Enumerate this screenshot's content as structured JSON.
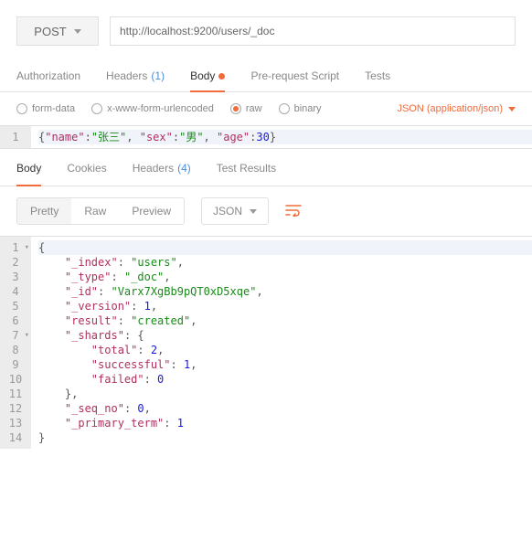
{
  "request": {
    "method": "POST",
    "url": "http://localhost:9200/users/_doc"
  },
  "reqTabs": {
    "authorization": "Authorization",
    "headers": "Headers",
    "headersCount": "(1)",
    "body": "Body",
    "prerequest": "Pre-request Script",
    "tests": "Tests"
  },
  "bodyTypes": {
    "formData": "form-data",
    "urlencoded": "x-www-form-urlencoded",
    "raw": "raw",
    "binary": "binary",
    "contentType": "JSON (application/json)"
  },
  "reqBody": {
    "line1": {
      "b1": "{",
      "k1": "\"name\"",
      "c1": ":",
      "v1": "\"张三\"",
      "c2": ", ",
      "k2": "\"sex\"",
      "c3": ":",
      "v2": "\"男\"",
      "c4": ", ",
      "k3": "\"age\"",
      "c5": ":",
      "v3": "30",
      "b2": "}"
    }
  },
  "respTabs": {
    "body": "Body",
    "cookies": "Cookies",
    "headers": "Headers",
    "headersCount": "(4)",
    "testResults": "Test Results"
  },
  "respToolbar": {
    "pretty": "Pretty",
    "raw": "Raw",
    "preview": "Preview",
    "lang": "JSON"
  },
  "respBody": {
    "l1": {
      "b": "{"
    },
    "l2": {
      "k": "\"_index\"",
      "v": "\"users\""
    },
    "l3": {
      "k": "\"_type\"",
      "v": "\"_doc\""
    },
    "l4": {
      "k": "\"_id\"",
      "v": "\"Varx7XgBb9pQT0xD5xqe\""
    },
    "l5": {
      "k": "\"_version\"",
      "v": "1"
    },
    "l6": {
      "k": "\"result\"",
      "v": "\"created\""
    },
    "l7": {
      "k": "\"_shards\"",
      "b": "{"
    },
    "l8": {
      "k": "\"total\"",
      "v": "2"
    },
    "l9": {
      "k": "\"successful\"",
      "v": "1"
    },
    "l10": {
      "k": "\"failed\"",
      "v": "0"
    },
    "l11": {
      "b": "},"
    },
    "l12": {
      "k": "\"_seq_no\"",
      "v": "0"
    },
    "l13": {
      "k": "\"_primary_term\"",
      "v": "1"
    },
    "l14": {
      "b": "}"
    }
  }
}
